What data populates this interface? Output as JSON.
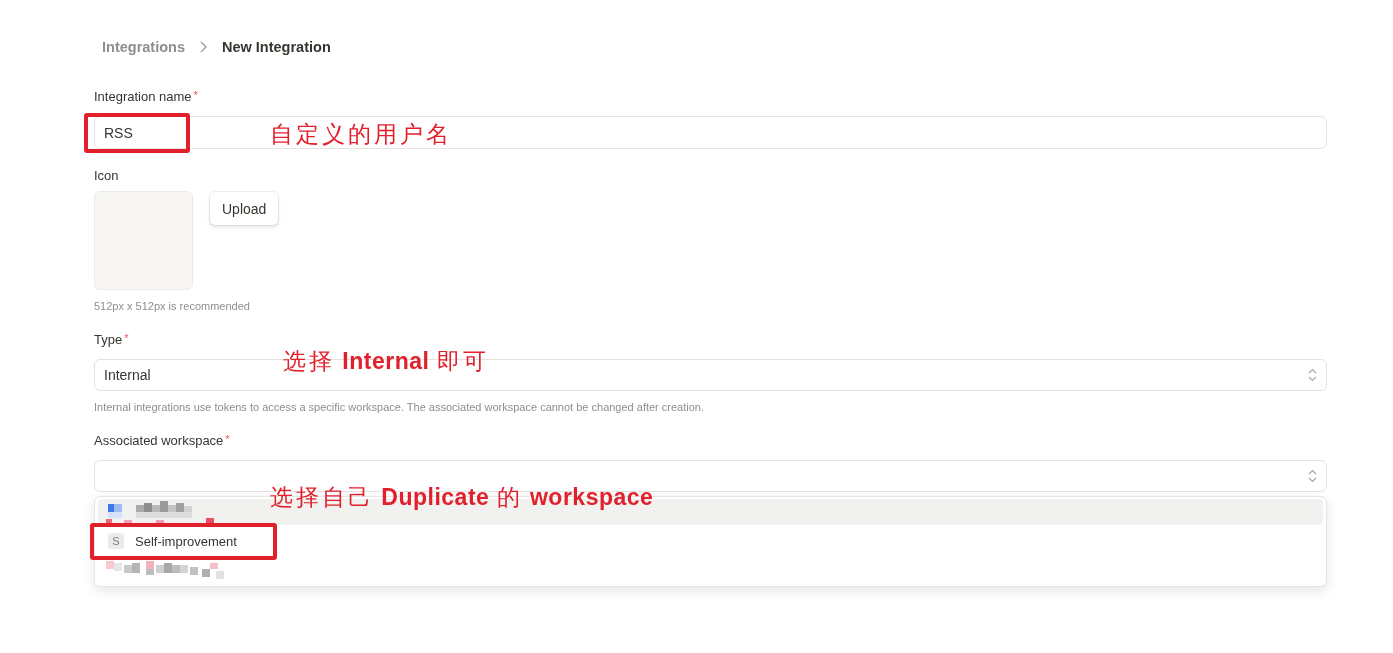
{
  "breadcrumb": [
    {
      "label": "Integrations",
      "current": false
    },
    {
      "label": "New Integration",
      "current": true
    }
  ],
  "fields": [
    {
      "kind": "text",
      "label": "Integration name",
      "required_mark": "*",
      "value": "RSS",
      "circled": true,
      "annotation": "自定义的用户名"
    },
    {
      "kind": "image-upload",
      "label": "Icon",
      "button": "Upload",
      "hint": "512px x 512px is recommended"
    },
    {
      "kind": "select",
      "label": "Type",
      "required_mark": "*",
      "value": "Internal",
      "circled": false,
      "hint": "Internal integrations use tokens to access a specific workspace. The associated workspace cannot be changed after creation.",
      "annotation": "选择 **Internal** 即可"
    },
    {
      "kind": "select",
      "label": "Associated workspace",
      "required_mark": "*",
      "circled": false,
      "open": true,
      "annotation": "选择自己 **Duplicate** 的 **workspace**",
      "options": [
        {
          "kind": "pixelated",
          "highlighted": true,
          "circled": false
        },
        {
          "kind": "workspace",
          "initial": "S",
          "label": "Self-improvement",
          "highlighted": false,
          "circled": true
        },
        {
          "kind": "pixelated",
          "highlighted": false,
          "circled": false
        }
      ]
    }
  ]
}
